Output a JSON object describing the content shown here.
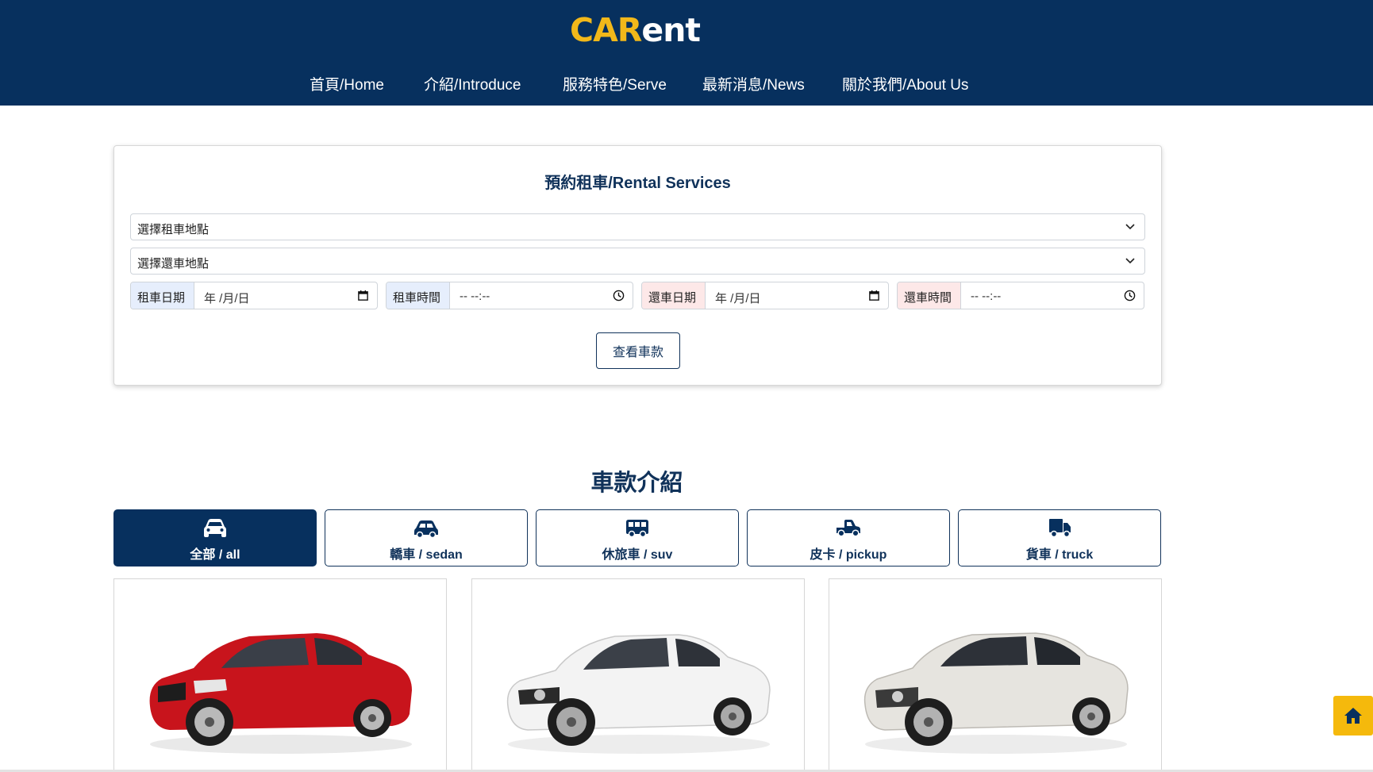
{
  "header": {
    "logo_part1": "CAR",
    "logo_part2": "ent",
    "nav": [
      "首頁/Home",
      "介紹/Introduce",
      "服務特色/Serve",
      "最新消息/News",
      "關於我們/About Us"
    ]
  },
  "rental": {
    "title": "預約租車/Rental Services",
    "pickup_location": "選擇租車地點",
    "return_location": "選擇還車地點",
    "pickup_date_label": "租車日期",
    "pickup_date_value": "年 /月/日",
    "pickup_time_label": "租車時間",
    "pickup_time_value": "-- --:--",
    "return_date_label": "還車日期",
    "return_date_value": "年 /月/日",
    "return_time_label": "還車時間",
    "return_time_value": "-- --:--",
    "view_button": "查看車款"
  },
  "cars": {
    "section_title": "車款介紹",
    "types": [
      {
        "label": "全部 / all",
        "icon": "car-front-icon",
        "active": true
      },
      {
        "label": "轎車 / sedan",
        "icon": "sedan-icon",
        "active": false
      },
      {
        "label": "休旅車 / suv",
        "icon": "van-icon",
        "active": false
      },
      {
        "label": "皮卡 / pickup",
        "icon": "pickup-icon",
        "active": false
      },
      {
        "label": "貨車 / truck",
        "icon": "truck-icon",
        "active": false
      }
    ],
    "cards": [
      {
        "color": "#c8141c",
        "name": "red-coupe"
      },
      {
        "color": "#f2f2f2",
        "name": "white-coupe"
      },
      {
        "color": "#e8e6e2",
        "name": "silver-sedan"
      }
    ]
  },
  "colors": {
    "navy": "#07305e",
    "accent": "#f2b81a",
    "home_button": "#f5b90c"
  }
}
